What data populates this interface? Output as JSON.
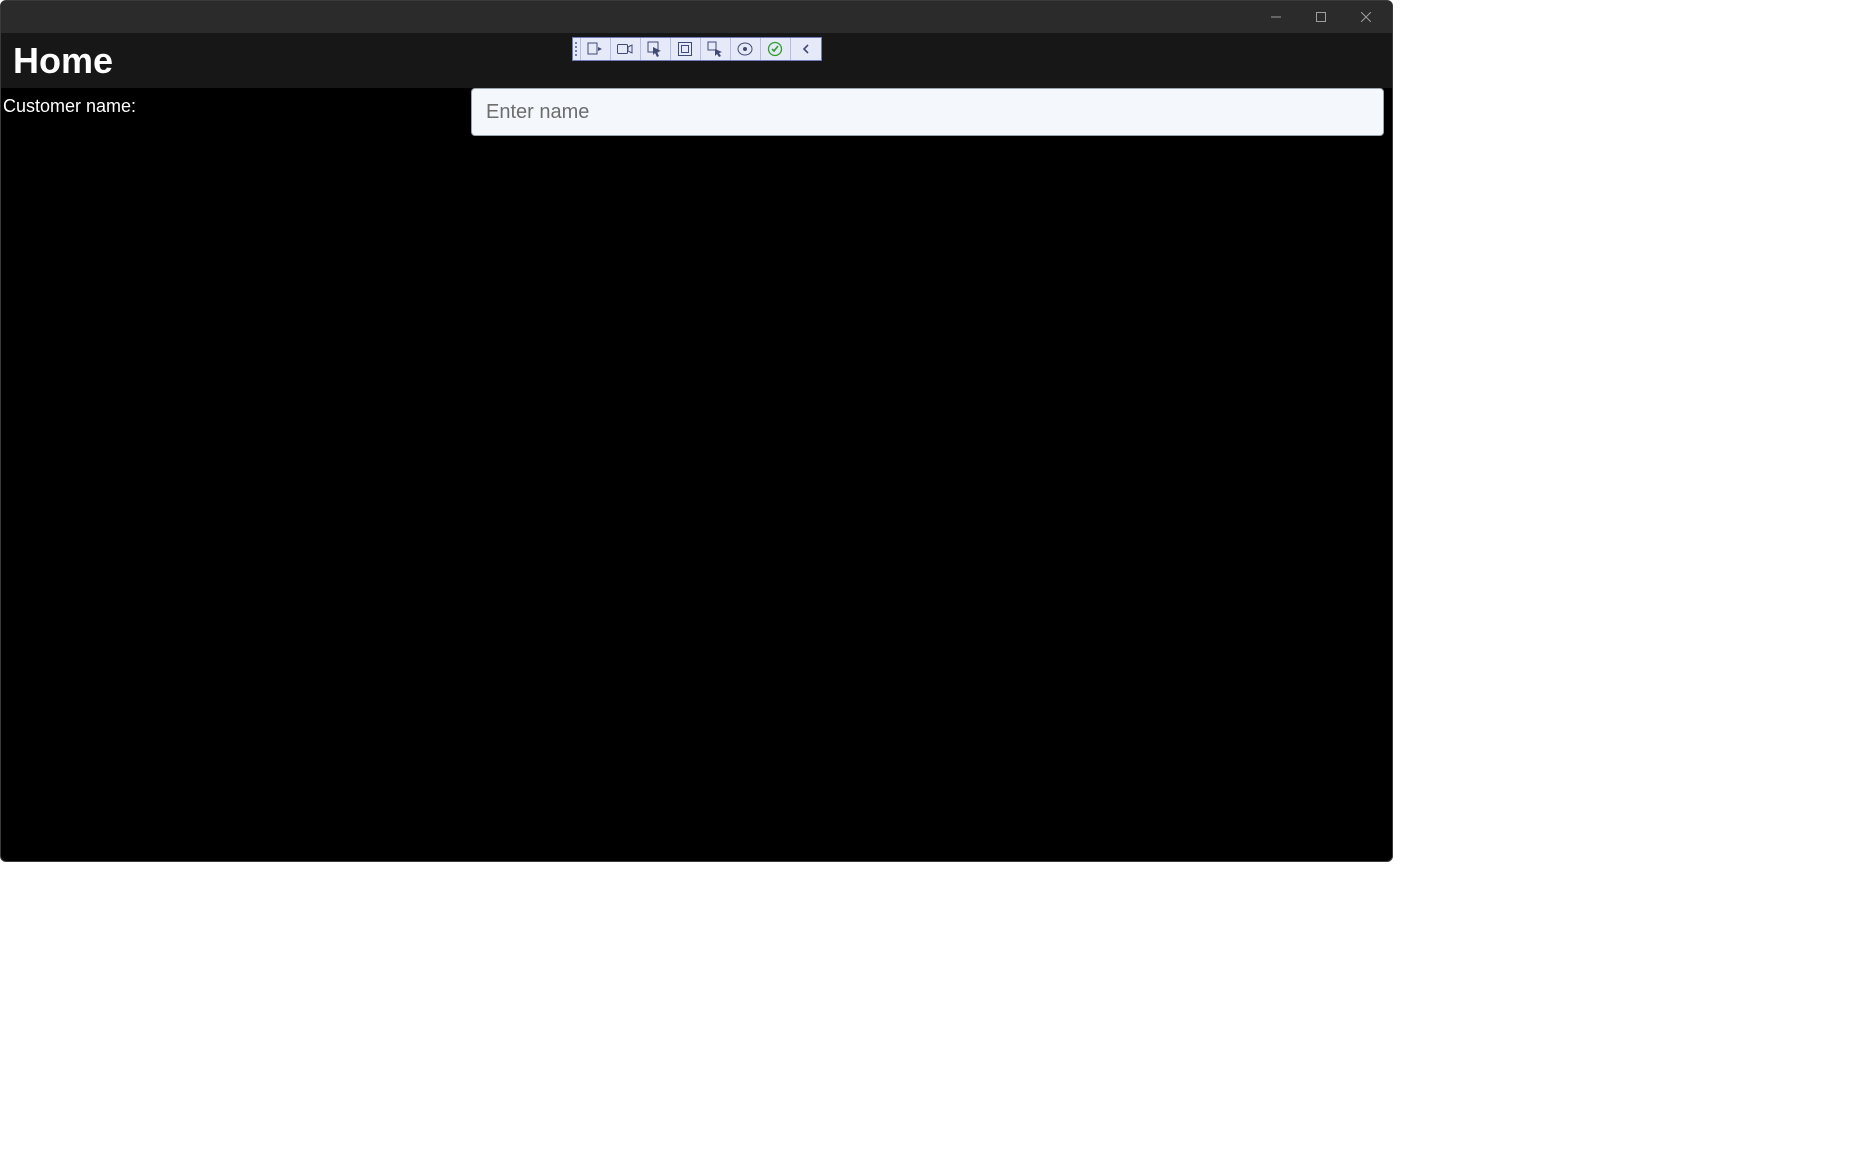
{
  "window": {
    "controls": {
      "minimize": "minimize",
      "maximize": "maximize",
      "close": "close"
    }
  },
  "header": {
    "title": "Home"
  },
  "debug_toolbar": {
    "buttons": [
      "live-visual-tree",
      "record",
      "select-element",
      "display-layout",
      "track-focus",
      "xaml-binding",
      "hot-reload-ok",
      "collapse"
    ]
  },
  "form": {
    "customer_name": {
      "label": "Customer name:",
      "placeholder": "Enter name",
      "value": ""
    }
  }
}
